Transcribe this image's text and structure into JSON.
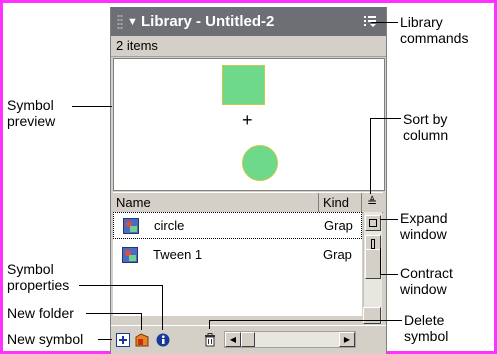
{
  "panel": {
    "title": "Library - Untitled-2",
    "item_count": "2 items",
    "columns": {
      "name": "Name",
      "kind": "Kind"
    },
    "rows": [
      {
        "name": "circle",
        "kind": "Grap",
        "selected": true
      },
      {
        "name": "Tween 1",
        "kind": "Grap",
        "selected": false
      }
    ]
  },
  "callouts": {
    "library_commands": [
      "Library",
      "commands"
    ],
    "symbol_preview": [
      "Symbol",
      "preview"
    ],
    "sort_by_column": [
      "Sort by",
      "column"
    ],
    "expand_window": [
      "Expand",
      "window"
    ],
    "contract_window": [
      "Contract",
      "window"
    ],
    "symbol_properties": [
      "Symbol",
      "properties"
    ],
    "new_folder": "New folder",
    "new_symbol": "New symbol",
    "delete_symbol": [
      "Delete",
      "symbol"
    ]
  },
  "colors": {
    "border": "#ff33ff",
    "titlebar": "#6d6f74",
    "preview_fill": "#6ed98a"
  }
}
